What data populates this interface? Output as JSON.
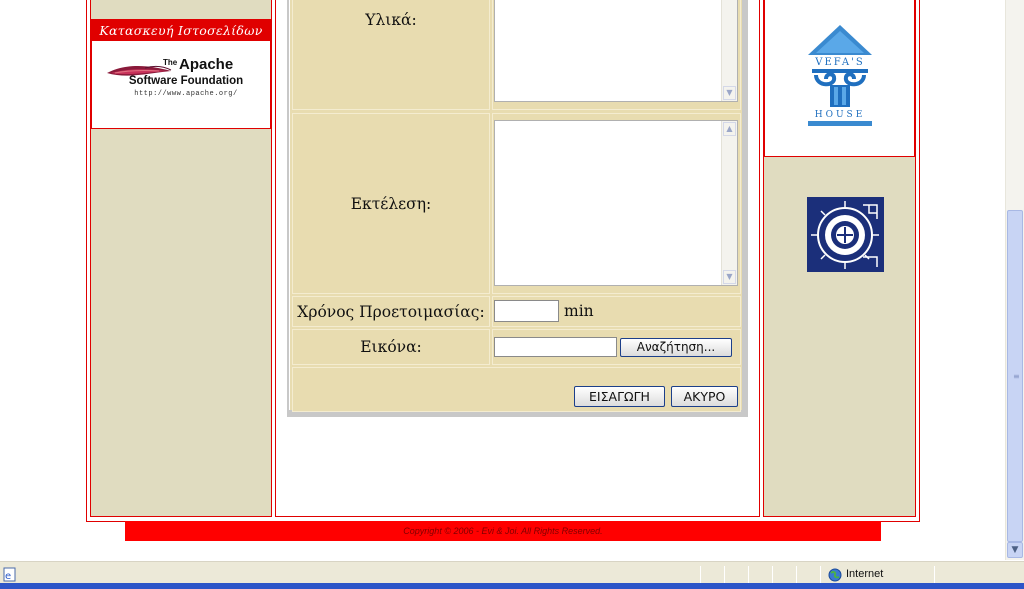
{
  "left_column": {
    "banner_title": "Κατασκευή Ιστοσελίδων",
    "apache_logo": {
      "the": "The",
      "name": "Apache",
      "foundation": "Software Foundation",
      "url": "http://www.apache.org/"
    }
  },
  "form": {
    "ingredients_label": "Υλικά:",
    "execution_label": "Εκτέλεση:",
    "prep_time_label": "Χρόνος Προετοιμασίας:",
    "prep_time_value": "",
    "prep_time_unit": "min",
    "image_label": "Εικόνα:",
    "image_value": "",
    "browse_button": "Αναζήτηση...",
    "submit_button": "ΕΙΣΑΓΩΓΗ",
    "cancel_button": "ΑΚΥΡΟ"
  },
  "right_column": {
    "vefas_logo_text": "Vefa's House",
    "vefas_logo_top": "VEFA'S",
    "vefas_logo_bottom": "HOUSE"
  },
  "footer": {
    "copyright": "Copyright © 2006 - Evi & Joi. All Rights Reserved."
  },
  "status_bar": {
    "zone": "Internet"
  },
  "colors": {
    "frame_red": "#e00000",
    "panel_tan": "#e0dcc0",
    "form_tan": "#e8dcb0",
    "footer_red": "#ff0000"
  }
}
